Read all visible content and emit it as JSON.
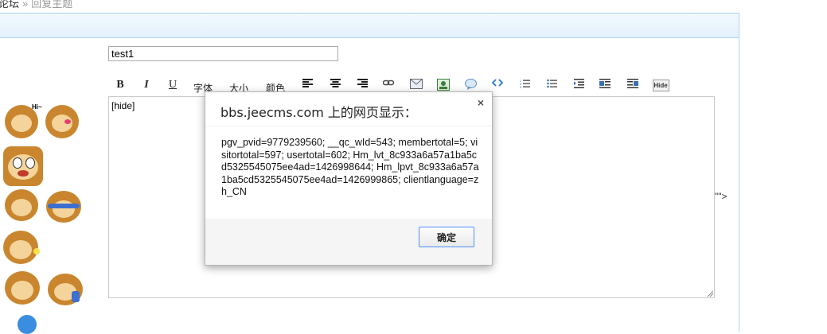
{
  "breadcrumb": {
    "forum": "论坛",
    "separator": "»",
    "current": "回复主题"
  },
  "form": {
    "title_value": "test1"
  },
  "toolbar": {
    "bold": "B",
    "italic": "I",
    "underline": "U",
    "font": "字体",
    "size": "大小",
    "color": "颜色",
    "icons": [
      "align-left-icon",
      "align-center-icon",
      "align-right-icon",
      "link-icon",
      "email-icon",
      "image-icon",
      "quote-icon",
      "code-icon",
      "ordered-list-icon",
      "unordered-list-icon",
      "indent-icon",
      "media-left-icon",
      "media-right-icon",
      "hide-icon"
    ],
    "hide_label": "Hide"
  },
  "editor": {
    "content": "[hide]"
  },
  "stray_text": "\"\">",
  "dialog": {
    "title": "bbs.jeecms.com 上的网页显示：",
    "close": "×",
    "message": "pgv_pvid=9779239560; __qc_wId=543; membertotal=5; visitortotal=597; usertotal=602; Hm_lvt_8c933a6a57a1ba5cd5325545075ee4ad=1426998644; Hm_lpvt_8c933a6a57a1ba5cd5325545075ee4ad=1426999865; clientlanguage=zh_CN",
    "ok_label": "确定"
  },
  "colors": {
    "panel_border": "#a8d2ef",
    "dialog_button_border": "#4d90fe",
    "monkey_fur": "#c9862e"
  }
}
